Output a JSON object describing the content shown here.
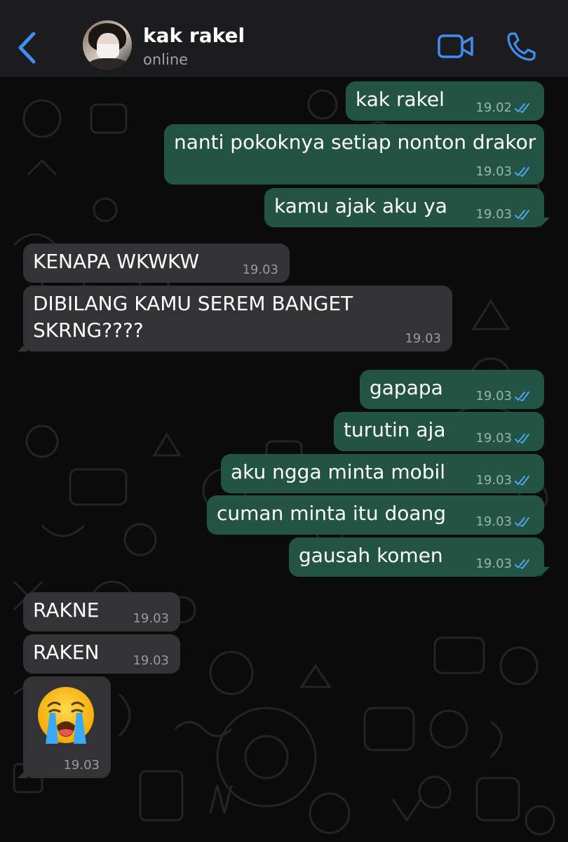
{
  "header": {
    "contact_name": "kak rakel",
    "status": "online",
    "back_icon": "chevron-left-icon",
    "video_icon": "video-camera-icon",
    "call_icon": "phone-icon",
    "accent_color": "#3d8df5"
  },
  "messages": [
    {
      "direction": "outgoing",
      "text": "kak rakel",
      "time": "19.02",
      "read": true
    },
    {
      "direction": "outgoing",
      "text": "nanti pokoknya setiap nonton drakor",
      "time": "19.03",
      "read": true
    },
    {
      "direction": "outgoing",
      "text": "kamu ajak aku ya",
      "time": "19.03",
      "read": true
    },
    {
      "direction": "incoming",
      "text": "KENAPA WKWKW",
      "time": "19.03"
    },
    {
      "direction": "incoming",
      "text_lines": [
        "DIBILANG KAMU SEREM BANGET",
        "SKRNG????"
      ],
      "time": "19.03"
    },
    {
      "direction": "outgoing",
      "text": "gapapa",
      "time": "19.03",
      "read": true
    },
    {
      "direction": "outgoing",
      "text": "turutin aja",
      "time": "19.03",
      "read": true
    },
    {
      "direction": "outgoing",
      "text": "aku ngga minta mobil",
      "time": "19.03",
      "read": true
    },
    {
      "direction": "outgoing",
      "text": "cuman minta itu doang",
      "time": "19.03",
      "read": true
    },
    {
      "direction": "outgoing",
      "text": "gausah komen",
      "time": "19.03",
      "read": true
    },
    {
      "direction": "incoming",
      "text": "RAKNE",
      "time": "19.03"
    },
    {
      "direction": "incoming",
      "text": "RAKEN",
      "time": "19.03"
    },
    {
      "direction": "incoming",
      "emoji": "loudly-crying-face-icon",
      "time": "19.03"
    }
  ],
  "colors": {
    "outgoing_bubble": "#235443",
    "incoming_bubble": "#333336",
    "read_ticks": "#4ea6f0",
    "background": "#0b0b0c"
  }
}
